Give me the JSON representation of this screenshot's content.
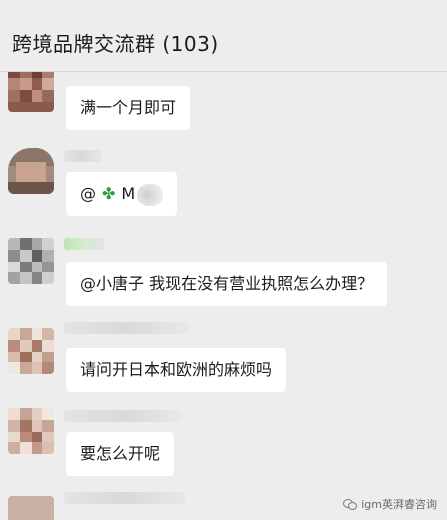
{
  "header": {
    "title": "跨境品牌交流群 (103)"
  },
  "messages": [
    {
      "text": "满一个月即可"
    },
    {
      "mention": "@",
      "trailing": "M"
    },
    {
      "text": "@小唐子 我现在没有营业执照怎么办理？"
    },
    {
      "text": "请问开日本和欧洲的麻烦吗"
    },
    {
      "text": "要怎么开呢"
    }
  ],
  "watermark": {
    "text": "igm英湃睿咨询"
  },
  "colors": {
    "background": "#ededed",
    "bubble": "#ffffff",
    "title": "#1a1a1a",
    "clover": "#2e9b3a"
  }
}
